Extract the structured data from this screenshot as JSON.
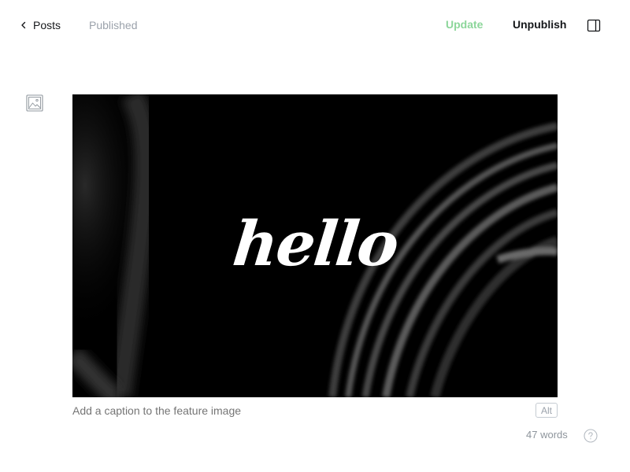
{
  "header": {
    "back_label": "Posts",
    "status": "Published",
    "update_label": "Update",
    "unpublish_label": "Unpublish",
    "icons": {
      "back": "chevron-left-icon",
      "settings": "sidebar-toggle-icon"
    }
  },
  "editor": {
    "image_toggle_icon": "image-icon",
    "feature_image": {
      "overlay_text": "hello"
    },
    "caption_placeholder": "Add a caption to the feature image",
    "alt_label": "Alt"
  },
  "footer": {
    "word_count": "47 words",
    "help_icon": "question-icon"
  },
  "colors": {
    "update_accent": "#8cd69a",
    "muted": "#9ba2ab",
    "text": "#15171a"
  }
}
